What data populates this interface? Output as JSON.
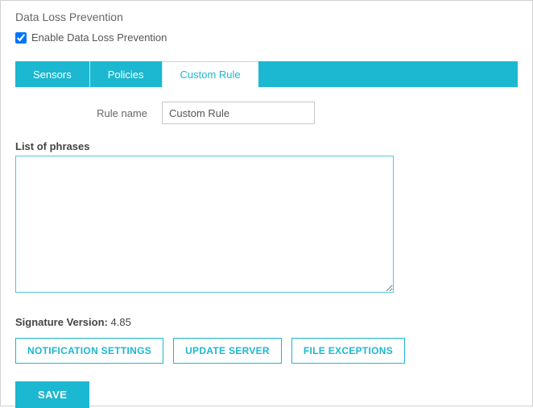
{
  "header": {
    "title": "Data Loss Prevention"
  },
  "enable": {
    "checked": true,
    "label": "Enable Data Loss Prevention"
  },
  "tabs": {
    "sensors": "Sensors",
    "policies": "Policies",
    "custom_rule": "Custom Rule",
    "active": "custom_rule"
  },
  "form": {
    "rule_name_label": "Rule name",
    "rule_name_value": "Custom Rule",
    "phrases_label": "List of phrases",
    "phrases_value": ""
  },
  "signature": {
    "label": "Signature Version:",
    "value": "4.85"
  },
  "buttons": {
    "notification_settings": "NOTIFICATION SETTINGS",
    "update_server": "UPDATE SERVER",
    "file_exceptions": "FILE EXCEPTIONS",
    "save": "SAVE"
  },
  "colors": {
    "accent": "#1cb7d0"
  }
}
